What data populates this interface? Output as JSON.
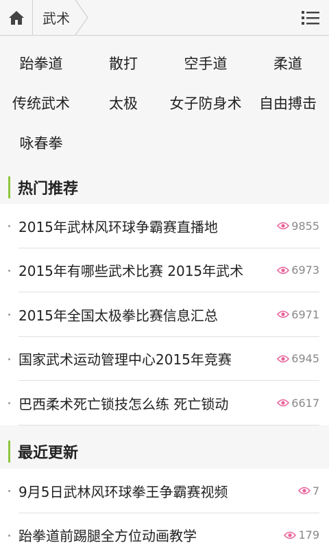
{
  "header": {
    "home_icon": "home-icon",
    "breadcrumb": "武术",
    "menu_icon": "list-menu-icon"
  },
  "categories": [
    "跆拳道",
    "散打",
    "空手道",
    "柔道",
    "传统武术",
    "太极",
    "女子防身术",
    "自由搏击",
    "咏春拳"
  ],
  "hot": {
    "title": "热门推荐",
    "items": [
      {
        "title": "2015年武林风环球争霸赛直播地",
        "views": "9855"
      },
      {
        "title": "2015年有哪些武术比赛 2015年武术",
        "views": "6973"
      },
      {
        "title": "2015年全国太极拳比赛信息汇总",
        "views": "6971"
      },
      {
        "title": "国家武术运动管理中心2015年竞赛",
        "views": "6945"
      },
      {
        "title": "巴西柔术死亡锁技怎么练 死亡锁动",
        "views": "6617"
      }
    ]
  },
  "recent": {
    "title": "最近更新",
    "items": [
      {
        "title": "9月5日武林风环球拳王争霸赛视频",
        "views": "7"
      },
      {
        "title": "跆拳道前踢腿全方位动画教学",
        "views": "179"
      }
    ]
  },
  "colors": {
    "accent": "#8cc63f",
    "eye_icon": "#e8629a"
  }
}
